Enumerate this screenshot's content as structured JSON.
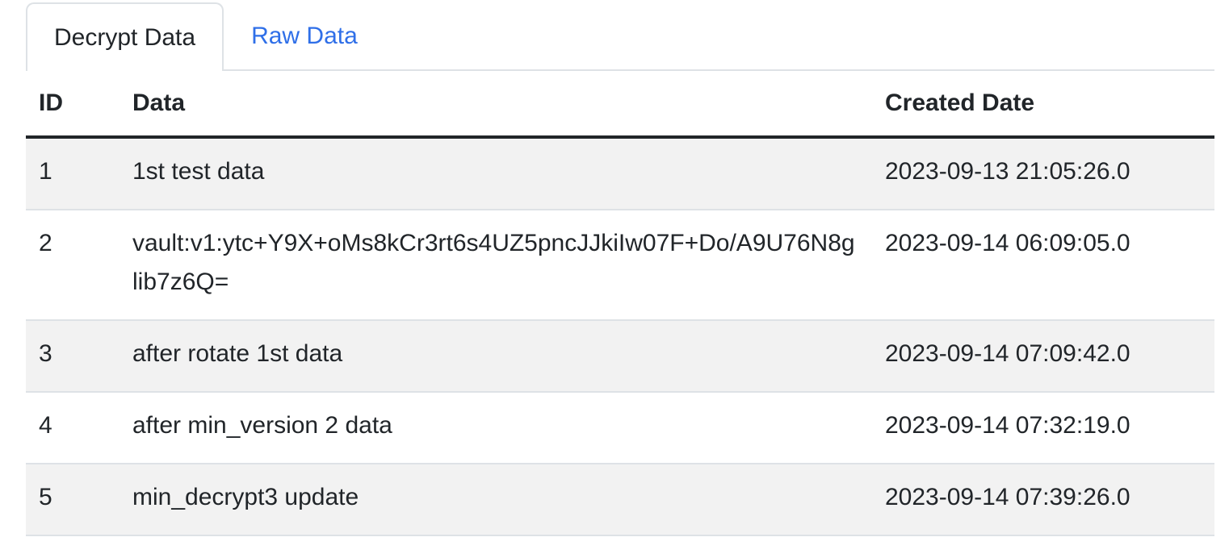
{
  "tabs": [
    {
      "label": "Decrypt Data",
      "active": true
    },
    {
      "label": "Raw Data",
      "active": false
    }
  ],
  "table": {
    "headers": [
      "ID",
      "Data",
      "Created Date"
    ],
    "rows": [
      {
        "id": "1",
        "data": "1st test data",
        "created": "2023-09-13 21:05:26.0"
      },
      {
        "id": "2",
        "data": "vault:v1:ytc+Y9X+oMs8kCr3rt6s4UZ5pncJJkiIw07F+Do/A9U76N8glib7z6Q=",
        "created": "2023-09-14 06:09:05.0"
      },
      {
        "id": "3",
        "data": "after rotate 1st data",
        "created": "2023-09-14 07:09:42.0"
      },
      {
        "id": "4",
        "data": "after min_version 2 data",
        "created": "2023-09-14 07:32:19.0"
      },
      {
        "id": "5",
        "data": "min_decrypt3 update",
        "created": "2023-09-14 07:39:26.0"
      }
    ]
  },
  "colors": {
    "link": "#2f6fe8",
    "stripe": "#f2f2f2",
    "border": "#dee2e6",
    "text": "#212529"
  }
}
